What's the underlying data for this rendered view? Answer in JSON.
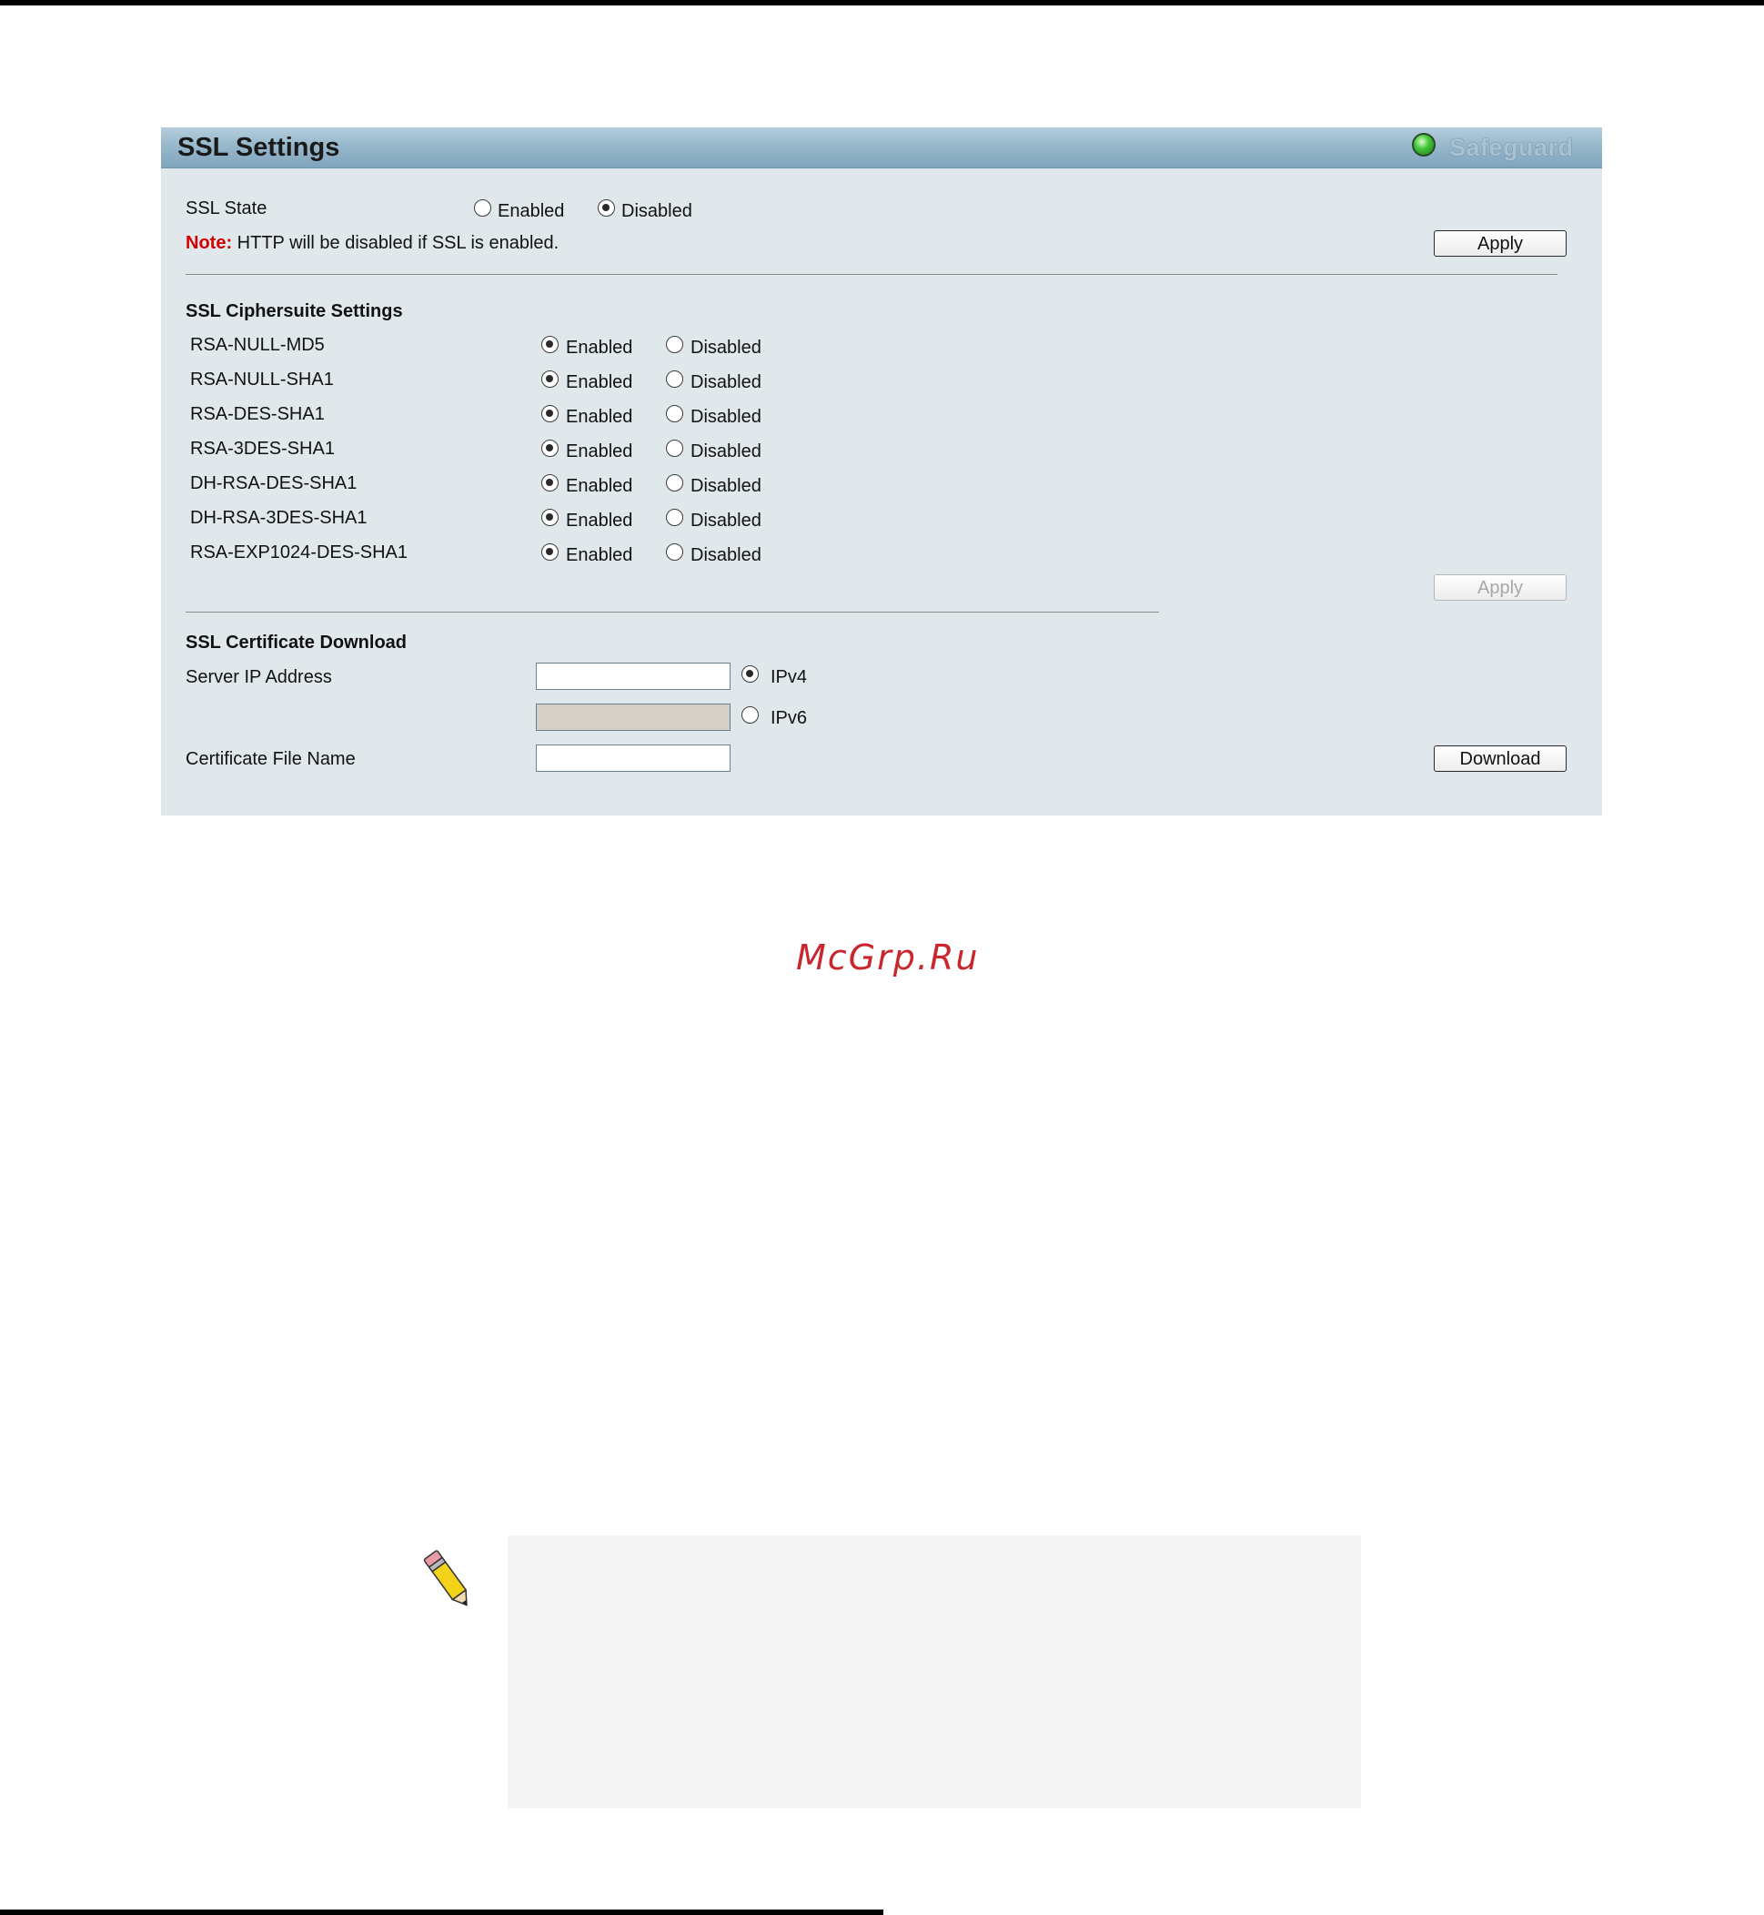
{
  "panel": {
    "title": "SSL Settings",
    "safeguard_label": "Safeguard"
  },
  "ssl_state": {
    "label": "SSL State",
    "enabled_label": "Enabled",
    "disabled_label": "Disabled",
    "selected": "Disabled",
    "note_label": "Note:",
    "note_text": "HTTP will be disabled if SSL is enabled.",
    "apply_label": "Apply"
  },
  "ciphersuite": {
    "heading": "SSL Ciphersuite Settings",
    "enabled_label": "Enabled",
    "disabled_label": "Disabled",
    "rows": [
      {
        "name": "RSA-NULL-MD5",
        "selected": "Enabled"
      },
      {
        "name": "RSA-NULL-SHA1",
        "selected": "Enabled"
      },
      {
        "name": "RSA-DES-SHA1",
        "selected": "Enabled"
      },
      {
        "name": "RSA-3DES-SHA1",
        "selected": "Enabled"
      },
      {
        "name": "DH-RSA-DES-SHA1",
        "selected": "Enabled"
      },
      {
        "name": "DH-RSA-3DES-SHA1",
        "selected": "Enabled"
      },
      {
        "name": "RSA-EXP1024-DES-SHA1",
        "selected": "Enabled"
      }
    ],
    "apply_label": "Apply"
  },
  "certificate": {
    "heading": "SSL Certificate Download",
    "server_ip_label": "Server IP Address",
    "ipv4_label": "IPv4",
    "ipv6_label": "IPv6",
    "ip_version_selected": "IPv4",
    "ipv4_value": "",
    "ipv6_value": "",
    "file_name_label": "Certificate File Name",
    "file_name_value": "",
    "download_label": "Download"
  },
  "watermark": "McGrp.Ru",
  "colors": {
    "panel_bg": "#e1e8ec",
    "header_bg": "#98b8cc",
    "note_red": "#d40000",
    "watermark_red": "#c8272d"
  }
}
